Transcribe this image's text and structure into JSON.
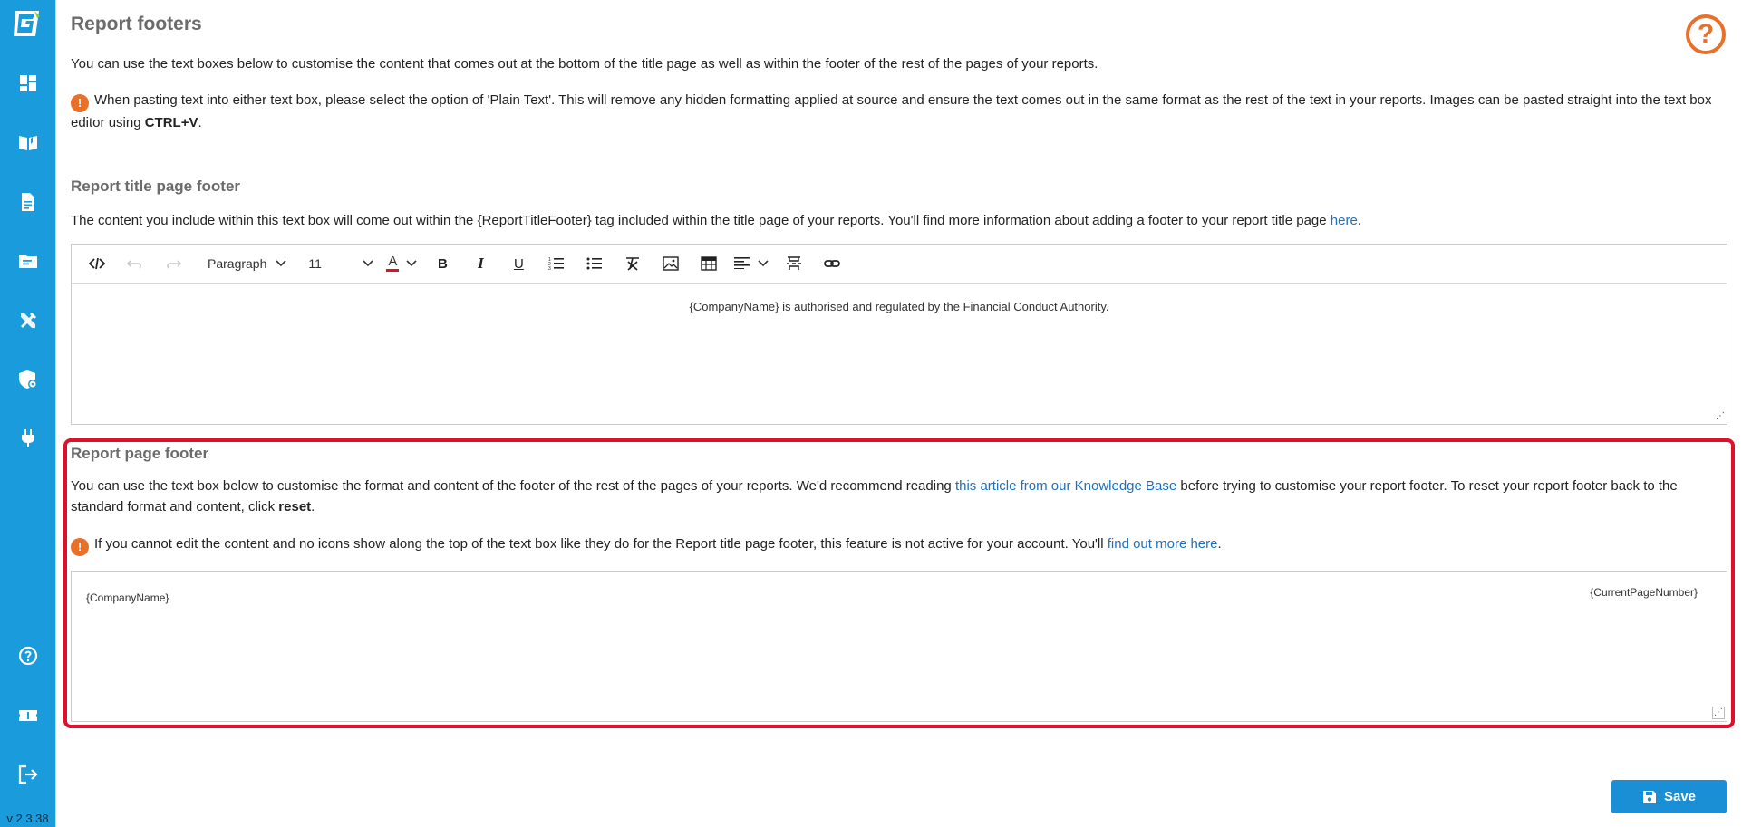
{
  "app": {
    "version": "v 2.3.38"
  },
  "sidebar": {
    "items": [
      {
        "icon": "dashboard-icon"
      },
      {
        "icon": "book-icon"
      },
      {
        "icon": "document-icon"
      },
      {
        "icon": "folder-icon"
      },
      {
        "icon": "tools-icon"
      },
      {
        "icon": "shield-gear-icon"
      },
      {
        "icon": "plug-icon"
      }
    ],
    "bottom_items": [
      {
        "icon": "help-circle-icon"
      },
      {
        "icon": "ticket-icon"
      },
      {
        "icon": "logout-icon"
      }
    ]
  },
  "page": {
    "title": "Report footers",
    "help_glyph": "?",
    "intro": "You can use the text boxes below to customise the content that comes out at the bottom of the title page as well as within the footer of the rest of the pages of your reports.",
    "paste_note_prefix": "When pasting text into either text box, please select the option of 'Plain Text'. This will remove any hidden formatting applied at source and ensure the text comes out in the same format as the rest of the text in your reports. Images can be pasted straight into the text box editor using ",
    "paste_note_shortcut": "CTRL+V",
    "paste_note_suffix": "."
  },
  "title_footer": {
    "heading": "Report title page footer",
    "desc_prefix": "The content you include within this text box will come out within the {ReportTitleFooter} tag included within the title page of your reports. You'll find more information about adding a footer to your report title page ",
    "desc_link": "here",
    "desc_suffix": ".",
    "toolbar": {
      "paragraph_label": "Paragraph",
      "font_size": "11",
      "font_color_glyph": "A",
      "bold_glyph": "B",
      "italic_glyph": "I",
      "underline_glyph": "U"
    },
    "content": "{CompanyName} is authorised and regulated by the Financial Conduct Authority."
  },
  "page_footer": {
    "heading": "Report page footer",
    "desc_prefix": "You can use the text box below to customise the format and content of the footer of the rest of the pages of your reports. We'd recommend reading ",
    "desc_link": "this article from our Knowledge Base",
    "desc_mid": " before trying to customise your report footer. To reset your report footer back to the standard format and content, click ",
    "desc_reset": "reset",
    "desc_suffix": ".",
    "note_prefix": "If you cannot edit the content and no icons show along the top of the text box like they do for the Report title page footer, this feature is not active for your account. You'll ",
    "note_link": "find out more here",
    "note_suffix": ".",
    "content_left": "{CompanyName}",
    "content_right": "{CurrentPageNumber}"
  },
  "actions": {
    "save_label": "Save"
  },
  "colors": {
    "sidebar": "#1a9bdc",
    "accent_orange": "#e8702a",
    "highlight_red": "#e0102a",
    "link_blue": "#1f6fbf",
    "save_blue": "#1a8fd6"
  }
}
